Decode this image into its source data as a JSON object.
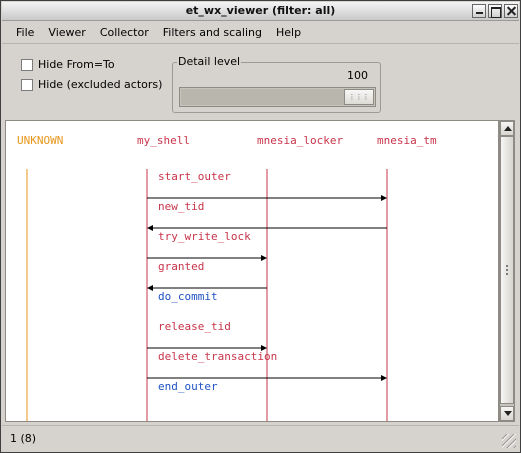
{
  "window": {
    "title": "et_wx_viewer (filter: all)"
  },
  "menu": {
    "items": [
      "File",
      "Viewer",
      "Collector",
      "Filters and scaling",
      "Help"
    ]
  },
  "controls": {
    "hide_from_to_label": "Hide From=To",
    "hide_excluded_label": "Hide (excluded actors)",
    "detail_level_label": "Detail level",
    "detail_level_value": "100",
    "detail_level_fraction": 1.0
  },
  "sequence": {
    "actors": [
      {
        "name": "UNKNOWN",
        "color": "#e8961a"
      },
      {
        "name": "my_shell",
        "color": "#c8344a"
      },
      {
        "name": "mnesia_locker",
        "color": "#c8344a"
      },
      {
        "name": "mnesia_tm",
        "color": "#c8344a"
      }
    ],
    "events": [
      {
        "label": "start_outer",
        "from": "my_shell",
        "to": "mnesia_tm",
        "kind": "message"
      },
      {
        "label": "new_tid",
        "from": "mnesia_tm",
        "to": "my_shell",
        "kind": "message"
      },
      {
        "label": "try_write_lock",
        "from": "my_shell",
        "to": "mnesia_locker",
        "kind": "message"
      },
      {
        "label": "granted",
        "from": "mnesia_locker",
        "to": "my_shell",
        "kind": "message"
      },
      {
        "label": "do_commit",
        "from": "my_shell",
        "to": "my_shell",
        "kind": "internal"
      },
      {
        "label": "release_tid",
        "from": "my_shell",
        "to": "mnesia_locker",
        "kind": "message"
      },
      {
        "label": "delete_transaction",
        "from": "my_shell",
        "to": "mnesia_tm",
        "kind": "message"
      },
      {
        "label": "end_outer",
        "from": "my_shell",
        "to": "my_shell",
        "kind": "internal"
      }
    ],
    "message_color": "#c8344a",
    "internal_color": "#1f52c4",
    "arrow_color": "#000000"
  },
  "status": {
    "text": "1 (8)"
  }
}
